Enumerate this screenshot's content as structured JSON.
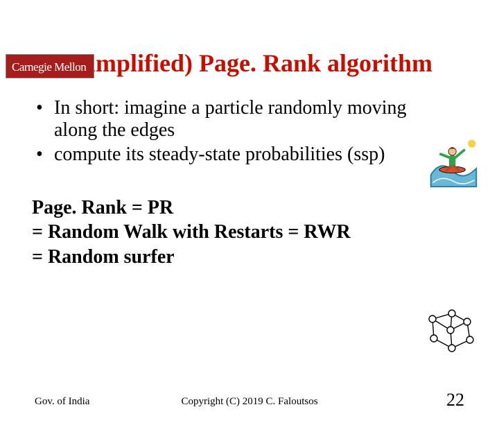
{
  "logo": {
    "text": "Carnegie Mellon"
  },
  "title": "(Simplified) Page. Rank algorithm",
  "bullets": [
    "In short: imagine a particle randomly moving along the edges",
    "compute its steady-state probabilities (ssp)"
  ],
  "equations": {
    "line1": "Page. Rank = PR",
    "line2": "= Random Walk with Restarts = RWR",
    "line3": "= Random surfer"
  },
  "footer": {
    "left": "Gov. of India",
    "center": "Copyright (C) 2019 C. Faloutsos",
    "right": "22"
  }
}
